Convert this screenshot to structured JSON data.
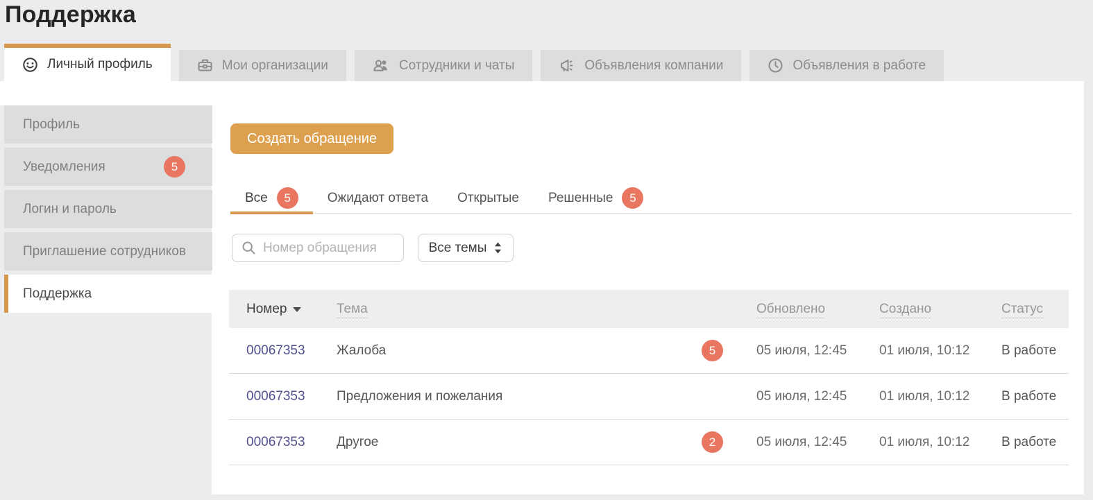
{
  "page": {
    "title": "Поддержка"
  },
  "tabs": [
    {
      "label": "Личный профиль",
      "icon": "smiley-icon",
      "active": true
    },
    {
      "label": "Мои организации",
      "icon": "briefcase-icon",
      "active": false
    },
    {
      "label": "Сотрудники и чаты",
      "icon": "people-icon",
      "active": false
    },
    {
      "label": "Объявления компании",
      "icon": "megaphone-icon",
      "active": false
    },
    {
      "label": "Объявления в работе",
      "icon": "clock-icon",
      "active": false
    }
  ],
  "sidebar": {
    "items": [
      {
        "label": "Профиль",
        "badge": ""
      },
      {
        "label": "Уведомления",
        "badge": "5"
      },
      {
        "label": "Логин и пароль",
        "badge": ""
      },
      {
        "label": "Приглашение сотрудников",
        "badge": ""
      },
      {
        "label": "Поддержка",
        "badge": "",
        "active": true
      }
    ]
  },
  "main": {
    "create_button": "Создать обращение",
    "filter_tabs": [
      {
        "label": "Все",
        "badge": "5",
        "active": true
      },
      {
        "label": "Ожидают ответа",
        "badge": ""
      },
      {
        "label": "Открытые",
        "badge": ""
      },
      {
        "label": "Решенные",
        "badge": "5"
      }
    ],
    "search": {
      "placeholder": "Номер обращения"
    },
    "topic_select": {
      "value": "Все темы"
    },
    "table": {
      "columns": {
        "number": "Номер",
        "topic": "Тема",
        "updated": "Обновлено",
        "created": "Создано",
        "status": "Статус"
      },
      "rows": [
        {
          "number": "00067353",
          "topic": "Жалоба",
          "badge": "5",
          "updated": "05 июля, 12:45",
          "created": "01 июля, 10:12",
          "status": "В работе"
        },
        {
          "number": "00067353",
          "topic": "Предложения и пожелания",
          "badge": "",
          "updated": "05 июля, 12:45",
          "created": "01 июля, 10:12",
          "status": "В работе"
        },
        {
          "number": "00067353",
          "topic": "Другое",
          "badge": "2",
          "updated": "05 июля, 12:45",
          "created": "01 июля, 10:12",
          "status": "В работе"
        }
      ]
    }
  },
  "colors": {
    "accent": "#d6984d",
    "button": "#dda04f",
    "badge": "#e87661",
    "link": "#50508e"
  }
}
